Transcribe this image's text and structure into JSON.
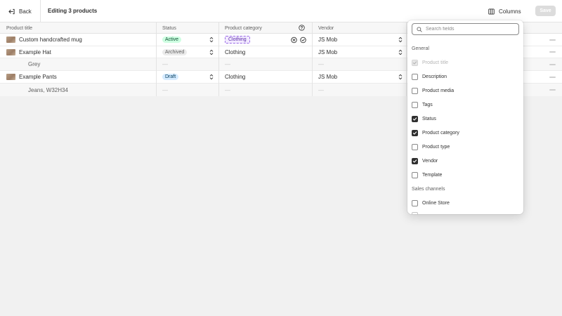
{
  "header": {
    "back_label": "Back",
    "title": "Editing 3 products",
    "columns_label": "Columns",
    "save_label": "Save"
  },
  "table": {
    "headers": {
      "title": "Product title",
      "status": "Status",
      "category": "Product category",
      "vendor": "Vendor"
    },
    "rows": [
      {
        "title": "Custom handcrafted mug",
        "status": "Active",
        "category": "Clothing",
        "vendor": "JS Mob"
      },
      {
        "title": "Example Hat",
        "status": "Archived",
        "category": "Clothing",
        "vendor": "JS Mob"
      },
      {
        "title": "Grey",
        "status": "—",
        "category": "—",
        "vendor": "—"
      },
      {
        "title": "Example Pants",
        "status": "Draft",
        "category": "Clothing",
        "vendor": "JS Mob"
      },
      {
        "title": "Jeans, W32H34",
        "status": "—",
        "category": "—",
        "vendor": "—"
      }
    ]
  },
  "columns_popover": {
    "search_placeholder": "Search fields",
    "sections": [
      {
        "label": "General",
        "options": [
          {
            "label": "Product title",
            "checked": true,
            "disabled": true
          },
          {
            "label": "Description",
            "checked": false
          },
          {
            "label": "Product media",
            "checked": false
          },
          {
            "label": "Tags",
            "checked": false
          },
          {
            "label": "Status",
            "checked": true
          },
          {
            "label": "Product category",
            "checked": true
          },
          {
            "label": "Product type",
            "checked": false
          },
          {
            "label": "Vendor",
            "checked": true
          },
          {
            "label": "Template",
            "checked": false
          }
        ]
      },
      {
        "label": "Sales channels",
        "options": [
          {
            "label": "Online Store",
            "checked": false
          }
        ]
      }
    ]
  },
  "colors": {
    "active_badge_bg": "#cdfee1",
    "archived_badge_bg": "#ebebeb",
    "draft_badge_bg": "#d5ebff",
    "editing_chip_border": "#9b6be6",
    "checkbox_checked": "#303030",
    "save_button_bg": "#dcdcdc"
  }
}
